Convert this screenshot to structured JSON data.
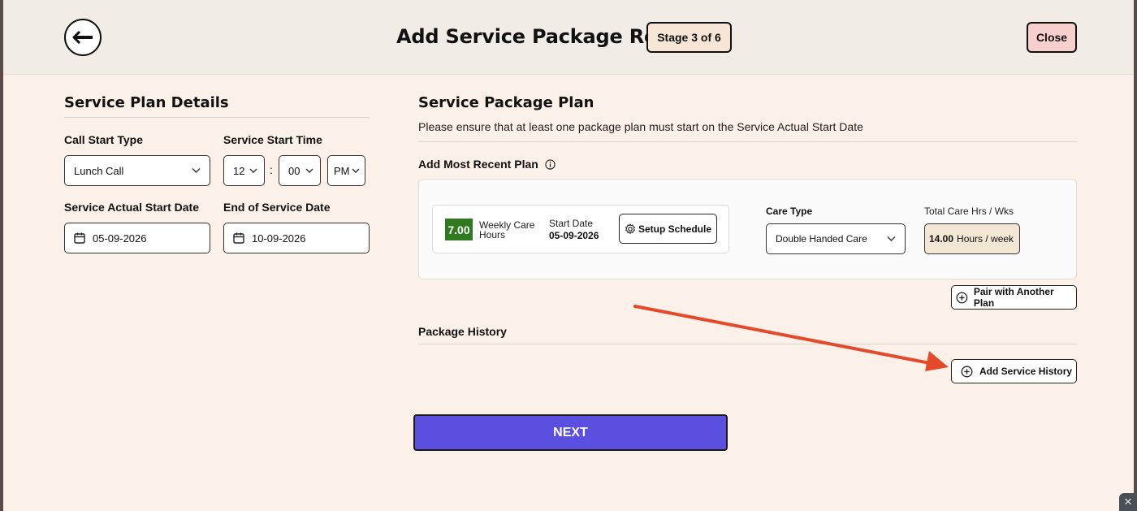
{
  "header": {
    "title": "Add Service Package Record",
    "stage": "Stage 3 of 6",
    "close_label": "Close"
  },
  "service_plan": {
    "title": "Service Plan Details",
    "call_start_type_label": "Call Start Type",
    "call_start_type_value": "Lunch Call",
    "service_start_time_label": "Service Start Time",
    "hour": "12",
    "colon": ":",
    "minute": "00",
    "ampm": "PM",
    "actual_start_date_label": "Service Actual Start Date",
    "actual_start_date_value": "05-09-2026",
    "end_date_label": "End of Service Date",
    "end_date_value": "10-09-2026"
  },
  "package_plan": {
    "title": "Service Package Plan",
    "note": "Please ensure that at least one package plan must start on the Service Actual Start Date",
    "add_recent_label": "Add Most Recent Plan",
    "plan": {
      "hours": "7.00",
      "hours_label_line1": "Weekly Care",
      "hours_label_line2": "Hours",
      "start_date_label": "Start Date",
      "start_date_value": "05-09-2026",
      "setup_label": "Setup Schedule",
      "care_type_label": "Care Type",
      "care_type_value": "Double Handed Care",
      "total_label": "Total Care Hrs / Wks",
      "total_value": "14.00",
      "total_unit": "Hours / week"
    },
    "pair_label": "Pair with Another Plan",
    "history_title": "Package History",
    "add_history_label": "Add Service History"
  },
  "footer": {
    "next_label": "NEXT"
  },
  "colors": {
    "accent": "#5b4fe0",
    "badge_green": "#2f7a1e",
    "arrow_red": "#e4492a",
    "close_bg": "#f7cfcc"
  }
}
